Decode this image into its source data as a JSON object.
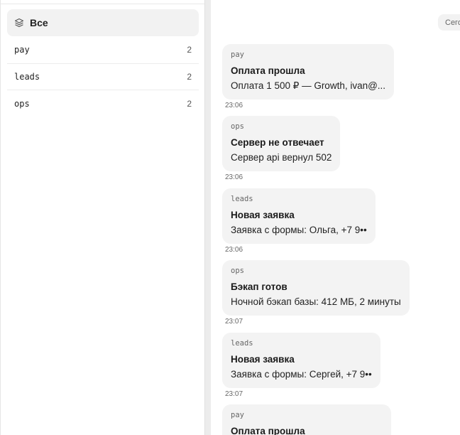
{
  "sidebar": {
    "all_label": "Все",
    "channels": [
      {
        "name": "pay",
        "count": "2"
      },
      {
        "name": "leads",
        "count": "2"
      },
      {
        "name": "ops",
        "count": "2"
      }
    ]
  },
  "feed": {
    "date_chip": "Сегодня",
    "messages": [
      {
        "channel": "pay",
        "title": "Оплата прошла",
        "body": "Оплата 1 500 ₽ — Growth, ivan@...",
        "time": "23:06"
      },
      {
        "channel": "ops",
        "title": "Сервер не отвечает",
        "body": "Сервер api вернул 502",
        "time": "23:06"
      },
      {
        "channel": "leads",
        "title": "Новая заявка",
        "body": "Заявка с формы: Ольга, +7 9••",
        "time": "23:06"
      },
      {
        "channel": "ops",
        "title": "Бэкап готов",
        "body": "Ночной бэкап базы: 412 МБ, 2 минуты",
        "time": "23:07"
      },
      {
        "channel": "leads",
        "title": "Новая заявка",
        "body": "Заявка с формы: Сергей, +7 9••",
        "time": "23:07"
      },
      {
        "channel": "pay",
        "title": "Оплата прошла",
        "body": "",
        "time": ""
      }
    ]
  }
}
